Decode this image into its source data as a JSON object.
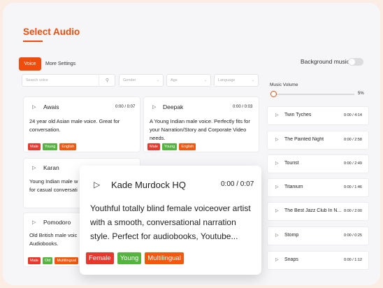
{
  "header": {
    "title": "Select Audio"
  },
  "tabs": {
    "voice": "Voice",
    "more": "More Settings"
  },
  "background_music": {
    "label": "Background music"
  },
  "filters": {
    "search_placeholder": "Search voice",
    "gender": "Gender",
    "age": "Age",
    "language": "Language"
  },
  "voices": [
    {
      "name": "Awais",
      "time": "0:00 / 0:07",
      "desc": [
        "24 year old Asian male voice. Great for",
        "conversation."
      ],
      "tags": [
        "Male",
        "Young",
        "English"
      ]
    },
    {
      "name": "Deepak",
      "time": "0:00 / 0:03",
      "desc": [
        "A Young Indian male voice. Perfectly fits for",
        "your Narration/Story and Corporate Video",
        "needs."
      ],
      "tags": [
        "Male",
        "Young",
        "English"
      ]
    },
    {
      "name": "Karan",
      "desc": [
        "Young Indian male w",
        "for casual conversati"
      ]
    },
    {
      "name": "Pomodoro",
      "desc": [
        "Old British male voic",
        "Audiobooks."
      ],
      "tags": [
        "Male",
        "Old",
        "Multilingual"
      ]
    }
  ],
  "music": {
    "volume_label": "Music Volume",
    "volume_pct": "5%",
    "volume_value": 0.05,
    "tracks": [
      {
        "name": "Twin Tyches",
        "time": "0:00 / 4:14"
      },
      {
        "name": "The Painted Night",
        "time": "0:00 / 2:58"
      },
      {
        "name": "Tourist",
        "time": "0:00 / 2:49"
      },
      {
        "name": "Titanium",
        "time": "0:00 / 1:46"
      },
      {
        "name": "The Best Jazz Club In N...",
        "time": "0:00 / 2:00"
      },
      {
        "name": "Stomp",
        "time": "0:00 / 0:25"
      },
      {
        "name": "Snaps",
        "time": "0:00 / 1:12"
      }
    ]
  },
  "featured": {
    "name": "Kade Murdock HQ",
    "time": "0:00 / 0:07",
    "desc": [
      "Youthful totally blind female voiceover artist",
      "with a smooth, conversational narration",
      "style. Perfect for audiobooks, Youtube..."
    ],
    "tags": [
      "Female",
      "Young",
      "Multilingual"
    ]
  },
  "colors": {
    "accent": "#f04d0c",
    "tag_red": "#e8382e",
    "tag_green": "#55b33f",
    "tag_orange": "#f2590e"
  }
}
